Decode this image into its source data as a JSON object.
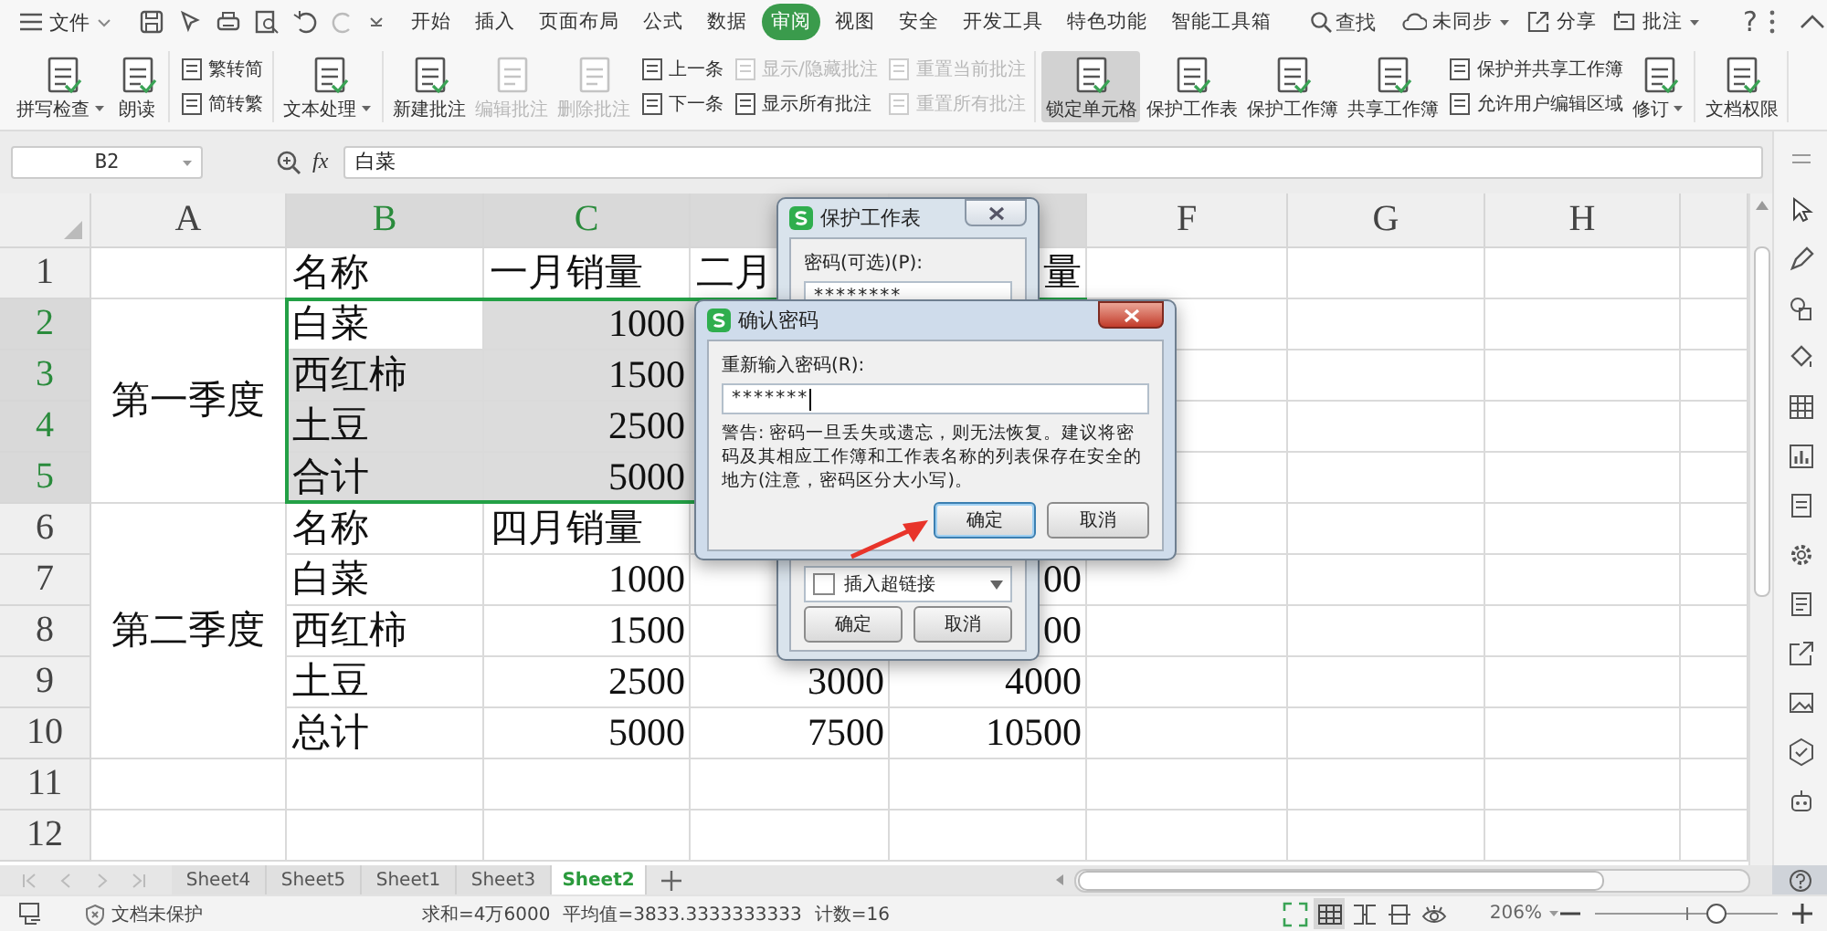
{
  "menu": {
    "file": "文件",
    "tabs": [
      {
        "label": "开始",
        "selected": false
      },
      {
        "label": "插入",
        "selected": false
      },
      {
        "label": "页面布局",
        "selected": false
      },
      {
        "label": "公式",
        "selected": false
      },
      {
        "label": "数据",
        "selected": false
      },
      {
        "label": "审阅",
        "selected": true
      },
      {
        "label": "视图",
        "selected": false
      },
      {
        "label": "安全",
        "selected": false
      },
      {
        "label": "开发工具",
        "selected": false
      },
      {
        "label": "特色功能",
        "selected": false
      },
      {
        "label": "智能工具箱",
        "selected": false
      }
    ],
    "search": "查找",
    "account": [
      {
        "label": "未同步",
        "dropdown": true
      },
      {
        "label": "分享",
        "dropdown": false
      },
      {
        "label": "批注",
        "dropdown": true
      }
    ],
    "help": "?"
  },
  "ribbon": [
    {
      "items": [
        {
          "kind": "large",
          "label": "拼写检查",
          "dropdown": true,
          "disabled": false,
          "pressed": false
        },
        {
          "kind": "large",
          "label": "朗读",
          "dropdown": false,
          "disabled": false,
          "pressed": false
        }
      ]
    },
    {
      "items": [
        {
          "kind": "stack",
          "items": [
            {
              "label": "繁转简",
              "disabled": false
            },
            {
              "label": "简转繁",
              "disabled": false
            }
          ]
        }
      ]
    },
    {
      "items": [
        {
          "kind": "large",
          "label": "文本处理",
          "dropdown": true,
          "disabled": false,
          "pressed": false
        }
      ]
    },
    {
      "items": [
        {
          "kind": "large",
          "label": "新建批注",
          "dropdown": false,
          "disabled": false,
          "pressed": false
        },
        {
          "kind": "large",
          "label": "编辑批注",
          "dropdown": false,
          "disabled": true,
          "pressed": false
        },
        {
          "kind": "large",
          "label": "删除批注",
          "dropdown": false,
          "disabled": true,
          "pressed": false
        },
        {
          "kind": "stack",
          "items": [
            {
              "label": "上一条",
              "disabled": false
            },
            {
              "label": "下一条",
              "disabled": false
            }
          ]
        },
        {
          "kind": "stack",
          "items": [
            {
              "label": "显示/隐藏批注",
              "disabled": true
            },
            {
              "label": "显示所有批注",
              "disabled": false
            }
          ]
        },
        {
          "kind": "stack",
          "items": [
            {
              "label": "重置当前批注",
              "disabled": true
            },
            {
              "label": "重置所有批注",
              "disabled": true
            }
          ]
        }
      ]
    },
    {
      "items": [
        {
          "kind": "large",
          "label": "锁定单元格",
          "dropdown": false,
          "disabled": false,
          "pressed": true
        },
        {
          "kind": "large",
          "label": "保护工作表",
          "dropdown": false,
          "disabled": false,
          "pressed": false
        },
        {
          "kind": "large",
          "label": "保护工作簿",
          "dropdown": false,
          "disabled": false,
          "pressed": false
        },
        {
          "kind": "large",
          "label": "共享工作簿",
          "dropdown": false,
          "disabled": false,
          "pressed": false
        },
        {
          "kind": "stack",
          "items": [
            {
              "label": "保护并共享工作簿",
              "disabled": false
            },
            {
              "label": "允许用户编辑区域",
              "disabled": false
            }
          ]
        },
        {
          "kind": "large",
          "label": "修订",
          "dropdown": true,
          "disabled": false,
          "pressed": false
        }
      ]
    },
    {
      "items": [
        {
          "kind": "large",
          "label": "文档权限",
          "dropdown": false,
          "disabled": false,
          "pressed": false
        }
      ]
    }
  ],
  "formula_bar": {
    "cell": "B2",
    "fx": "fx",
    "value": "白菜"
  },
  "sheet": {
    "columns": [
      {
        "label": "A",
        "selected": false
      },
      {
        "label": "B",
        "selected": true
      },
      {
        "label": "C",
        "selected": true
      },
      {
        "selected": true
      },
      {
        "selected": true
      },
      {
        "label": "F",
        "selected": false
      },
      {
        "label": "G",
        "selected": false
      },
      {
        "label": "H",
        "selected": false
      }
    ],
    "rows": [
      {
        "label": "1",
        "selected": false,
        "cells": [
          {
            "kind": "empty"
          },
          {
            "kind": "text",
            "text": "名称"
          },
          {
            "kind": "text",
            "text": "一月销量"
          },
          {
            "kind": "text",
            "text": "二月"
          },
          {
            "kind": "tail",
            "text": "量"
          },
          {
            "kind": "empty"
          },
          {
            "kind": "empty"
          },
          {
            "kind": "empty"
          }
        ]
      },
      {
        "label": "2",
        "selected": true,
        "cells": [
          {
            "kind": "text",
            "text": "第一季度"
          },
          {
            "kind": "text",
            "text": "白菜"
          },
          {
            "kind": "number",
            "text": "1000"
          },
          {
            "kind": "empty"
          },
          {
            "kind": "covered"
          },
          {
            "kind": "empty"
          },
          {
            "kind": "empty"
          },
          {
            "kind": "empty"
          }
        ]
      },
      {
        "label": "3",
        "selected": true,
        "cells": [
          {
            "kind": "merged"
          },
          {
            "kind": "text",
            "text": "西红柿"
          },
          {
            "kind": "number",
            "text": "1500"
          },
          {
            "kind": "empty"
          },
          {
            "kind": "covered"
          },
          {
            "kind": "empty"
          },
          {
            "kind": "empty"
          },
          {
            "kind": "empty"
          }
        ]
      },
      {
        "label": "4",
        "selected": true,
        "cells": [
          {
            "kind": "merged"
          },
          {
            "kind": "text",
            "text": "土豆"
          },
          {
            "kind": "number",
            "text": "2500"
          },
          {
            "kind": "empty"
          },
          {
            "kind": "covered"
          },
          {
            "kind": "empty"
          },
          {
            "kind": "empty"
          },
          {
            "kind": "empty"
          }
        ]
      },
      {
        "label": "5",
        "selected": true,
        "cells": [
          {
            "kind": "merged"
          },
          {
            "kind": "text",
            "text": "合计"
          },
          {
            "kind": "number",
            "text": "5000"
          },
          {
            "kind": "empty"
          },
          {
            "kind": "covered"
          },
          {
            "kind": "empty"
          },
          {
            "kind": "empty"
          },
          {
            "kind": "empty"
          }
        ]
      },
      {
        "label": "6",
        "selected": false,
        "cells": [
          {
            "kind": "text",
            "text": "第二季度"
          },
          {
            "kind": "text",
            "text": "名称"
          },
          {
            "kind": "text",
            "text": "四月销量"
          },
          {
            "kind": "empty"
          },
          {
            "kind": "empty"
          },
          {
            "kind": "empty"
          },
          {
            "kind": "empty"
          },
          {
            "kind": "empty"
          }
        ]
      },
      {
        "label": "7",
        "selected": false,
        "cells": [
          {
            "kind": "merged"
          },
          {
            "kind": "text",
            "text": "白菜"
          },
          {
            "kind": "number",
            "text": "1000"
          },
          {
            "kind": "empty"
          },
          {
            "kind": "number",
            "text": "00"
          },
          {
            "kind": "empty"
          },
          {
            "kind": "empty"
          },
          {
            "kind": "empty"
          }
        ]
      },
      {
        "label": "8",
        "selected": false,
        "cells": [
          {
            "kind": "merged"
          },
          {
            "kind": "text",
            "text": "西红柿"
          },
          {
            "kind": "number",
            "text": "1500"
          },
          {
            "kind": "empty"
          },
          {
            "kind": "number",
            "text": "00"
          },
          {
            "kind": "empty"
          },
          {
            "kind": "empty"
          },
          {
            "kind": "empty"
          }
        ]
      },
      {
        "label": "9",
        "selected": false,
        "cells": [
          {
            "kind": "merged"
          },
          {
            "kind": "text",
            "text": "土豆"
          },
          {
            "kind": "number",
            "text": "2500"
          },
          {
            "kind": "number",
            "text": "3000"
          },
          {
            "kind": "number",
            "text": "4000"
          },
          {
            "kind": "empty"
          },
          {
            "kind": "empty"
          },
          {
            "kind": "empty"
          }
        ]
      },
      {
        "label": "10",
        "selected": false,
        "cells": [
          {
            "kind": "merged"
          },
          {
            "kind": "text",
            "text": "总计"
          },
          {
            "kind": "number",
            "text": "5000"
          },
          {
            "kind": "number",
            "text": "7500"
          },
          {
            "kind": "number",
            "text": "10500"
          },
          {
            "kind": "empty"
          },
          {
            "kind": "empty"
          },
          {
            "kind": "empty"
          }
        ]
      },
      {
        "label": "11",
        "selected": false
      },
      {
        "label": "12",
        "selected": false
      }
    ]
  },
  "sheet_tabs": [
    {
      "label": "Sheet4",
      "selected": false
    },
    {
      "label": "Sheet5",
      "selected": false
    },
    {
      "label": "Sheet1",
      "selected": false
    },
    {
      "label": "Sheet3",
      "selected": false
    },
    {
      "label": "Sheet2",
      "selected": true
    }
  ],
  "status_bar": {
    "protection": "文档未保护",
    "stats": [
      "求和=4万6000",
      "平均值=3833.3333333333",
      "计数=16"
    ],
    "view_buttons": [
      {
        "selected": false
      },
      {
        "selected": true
      },
      {
        "selected": false
      },
      {
        "selected": false
      },
      {
        "selected": false
      }
    ],
    "zoom": "206%",
    "zoom_slider": {
      "level": 0.66
    }
  },
  "dialogs": [
    {
      "kind": "protect",
      "active": false,
      "title": "保护工作表",
      "field_label": "密码(可选)(P):",
      "password": "********",
      "options": [
        {
          "label": "插入超链接",
          "checked": false
        }
      ],
      "buttons": [
        {
          "label": "确定",
          "default": false
        },
        {
          "label": "取消",
          "default": false
        }
      ]
    },
    {
      "kind": "confirm",
      "active": true,
      "title": "确认密码",
      "field_label": "重新输入密码(R):",
      "password": "*******",
      "warning": "警告: 密码一旦丢失或遗忘，则无法恢复。建议将密码及其相应工作簿和工作表名称的列表保存在安全的地方(注意，密码区分大小写)。",
      "buttons": [
        {
          "label": "确定",
          "default": true
        },
        {
          "label": "取消",
          "default": false
        }
      ]
    }
  ]
}
